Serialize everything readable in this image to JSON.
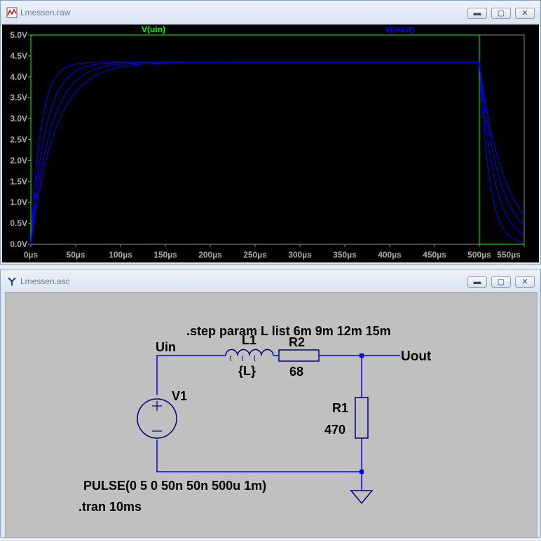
{
  "waveform_window": {
    "title": "Lmessen.raw",
    "icon": "waveform-icon",
    "controls": {
      "minimize": "▬",
      "maximize": "▢",
      "close": "✕"
    }
  },
  "schematic_window": {
    "title": "Lmessen.asc",
    "icon": "schematic-icon",
    "controls": {
      "minimize": "▬",
      "maximize": "▢",
      "close": "✕"
    }
  },
  "chart_data": {
    "type": "line",
    "legend": [
      {
        "name": "V(uin)",
        "color": "#00ff00"
      },
      {
        "name": "V(uout)",
        "color": "#0000ff"
      }
    ],
    "x": {
      "unit": "µs",
      "range": [
        0,
        550
      ],
      "ticks": [
        "0µs",
        "50µs",
        "100µs",
        "150µs",
        "200µs",
        "250µs",
        "300µs",
        "350µs",
        "400µs",
        "450µs",
        "500µs",
        "550µs"
      ]
    },
    "y": {
      "unit": "V",
      "range": [
        0,
        5
      ],
      "ticks": [
        "0.0V",
        "0.5V",
        "1.0V",
        "1.5V",
        "2.0V",
        "2.5V",
        "3.0V",
        "3.5V",
        "4.0V",
        "4.5V",
        "5.0V"
      ]
    },
    "grid": false,
    "pulse": {
      "high": 5,
      "on_until_us": 500
    },
    "steady_state": 4.35,
    "series": [
      {
        "param": "6m",
        "tau_us": 11
      },
      {
        "param": "9m",
        "tau_us": 16.5
      },
      {
        "param": "12m",
        "tau_us": 22
      },
      {
        "param": "15m",
        "tau_us": 27.5
      }
    ]
  },
  "schematic": {
    "step_directive": ".step param L list 6m 9m 12m 15m",
    "net_in": "Uin",
    "net_out": "Uout",
    "L1": {
      "name": "L1",
      "value": "{L}"
    },
    "R2": {
      "name": "R2",
      "value": "68"
    },
    "R1": {
      "name": "R1",
      "value": "470"
    },
    "V1": {
      "name": "V1",
      "value": "PULSE(0 5 0 50n 50n 500u 1m)"
    },
    "tran": ".tran 10ms",
    "wire_color": "#0000ff",
    "component_color": "#000080"
  }
}
